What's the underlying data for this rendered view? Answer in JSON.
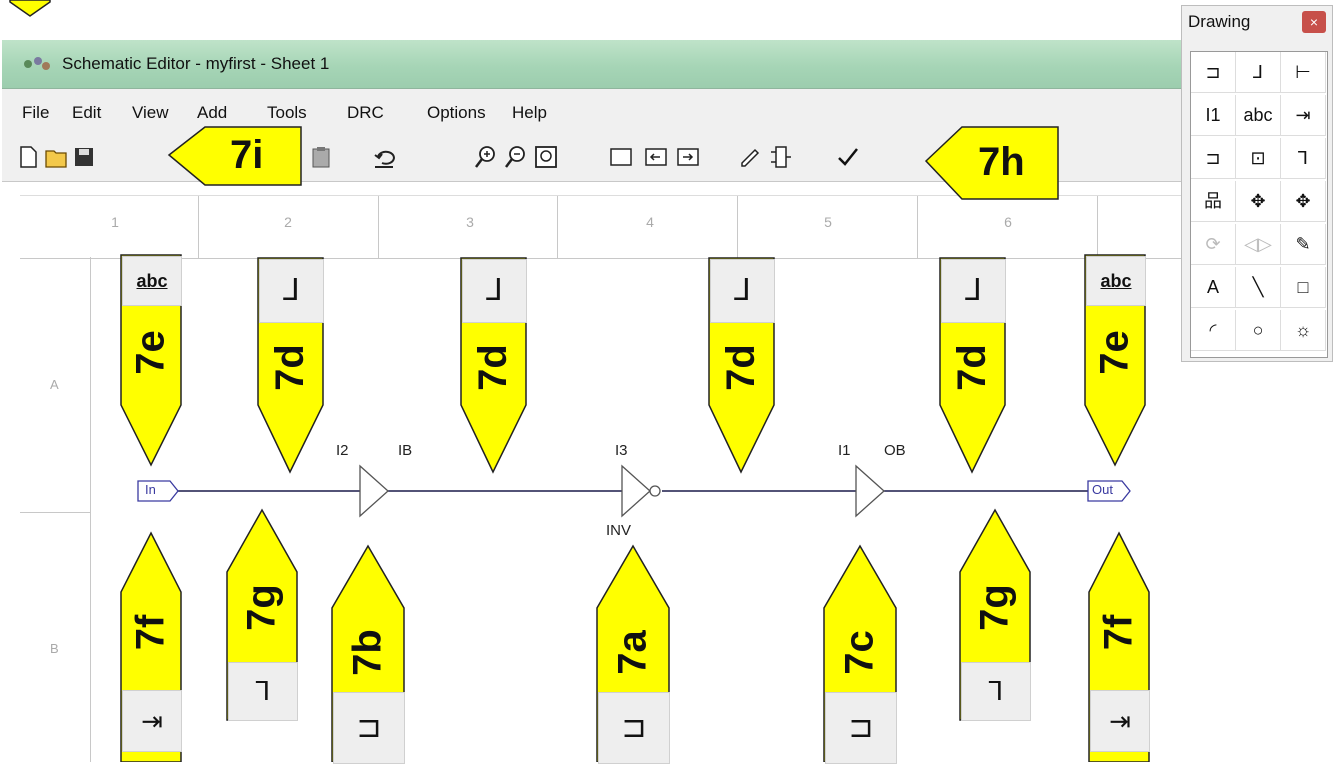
{
  "window": {
    "title": "Schematic Editor - myfirst - Sheet 1"
  },
  "menu": [
    "File",
    "Edit",
    "View",
    "Add",
    "Tools",
    "DRC",
    "Options",
    "Help"
  ],
  "toolbar": {
    "buttons": [
      "new-icon",
      "open-icon",
      "save-icon",
      "copy-icon",
      "paste-icon",
      "undo-icon",
      "zoom-in-icon",
      "zoom-out-icon",
      "zoom-fit-icon",
      "page-icon",
      "page-prev-icon",
      "page-next-icon",
      "edit-symbol-icon",
      "symbol-pins-icon",
      "check-icon"
    ]
  },
  "sheet": {
    "columns": [
      "1",
      "2",
      "3",
      "4",
      "5",
      "6"
    ],
    "rows": [
      "A",
      "B"
    ]
  },
  "palette": {
    "title": "Drawing",
    "close": "×",
    "tools": [
      {
        "name": "add-component-icon",
        "glyph": "⊐"
      },
      {
        "name": "add-wire-icon",
        "glyph": "⅃"
      },
      {
        "name": "add-bus-icon",
        "glyph": "⊢"
      },
      {
        "name": "add-instance-name-icon",
        "glyph": "I1"
      },
      {
        "name": "add-net-name-icon",
        "glyph": "abc"
      },
      {
        "name": "add-io-marker-icon",
        "glyph": "⇥"
      },
      {
        "name": "add-bus-tap-icon",
        "glyph": "⊐"
      },
      {
        "name": "add-symbol-icon",
        "glyph": "⊡"
      },
      {
        "name": "add-branch-icon",
        "glyph": "⅂"
      },
      {
        "name": "hierarchy-icon",
        "glyph": "品"
      },
      {
        "name": "move-icon",
        "glyph": "✥"
      },
      {
        "name": "pan-icon",
        "glyph": "✥"
      },
      {
        "name": "rotate-icon",
        "glyph": "⟳"
      },
      {
        "name": "mirror-icon",
        "glyph": "◁▷"
      },
      {
        "name": "pencil-icon",
        "glyph": "✎"
      },
      {
        "name": "text-icon",
        "glyph": "A"
      },
      {
        "name": "line-icon",
        "glyph": "╲"
      },
      {
        "name": "rectangle-icon",
        "glyph": "□"
      },
      {
        "name": "arc-icon",
        "glyph": "◜"
      },
      {
        "name": "ellipse-icon",
        "glyph": "○"
      },
      {
        "name": "image-icon",
        "glyph": "☼"
      }
    ]
  },
  "schematic": {
    "in_marker": "In",
    "out_marker": "Out",
    "labels": {
      "i2": "I2",
      "ib": "IB",
      "i3": "I3",
      "inv": "INV",
      "i1": "I1",
      "ob": "OB"
    }
  },
  "callouts": {
    "7i": "7i",
    "7h": "7h",
    "7e_left": "7e",
    "7d_1": "7d",
    "7d_2": "7d",
    "7d_3": "7d",
    "7d_4": "7d",
    "7e_right": "7e",
    "7f_left": "7f",
    "7g_left": "7g",
    "7b": "7b",
    "7a": "7a",
    "7c": "7c",
    "7g_right": "7g",
    "7f_right": "7f"
  },
  "colors": {
    "callout_fill": "#ffff00",
    "callout_stroke": "#222222",
    "titlebar": "#a6d5b6",
    "wire": "#1a1a4a"
  }
}
